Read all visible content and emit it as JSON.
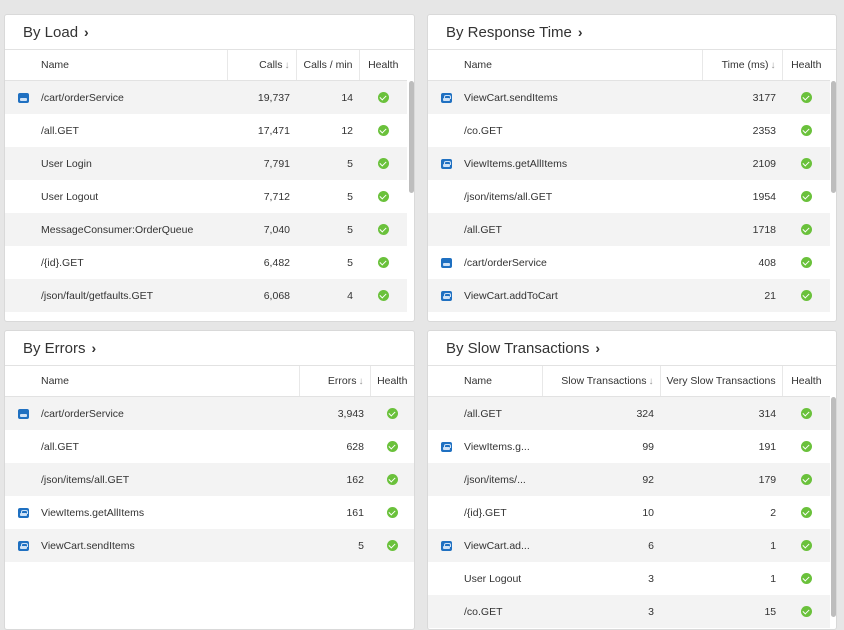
{
  "panels": {
    "load": {
      "title": "By Load",
      "chevron": "›",
      "headers": [
        "Name",
        "Calls",
        "Calls / min",
        "Health"
      ],
      "sort_arrow": "↓",
      "rows": [
        {
          "icon": "service-icon",
          "name": "/cart/orderService",
          "c1": "19,737",
          "c2": "14",
          "health": "ok-icon"
        },
        {
          "icon": "",
          "name": "/all.GET",
          "c1": "17,471",
          "c2": "12",
          "health": "ok-icon"
        },
        {
          "icon": "",
          "name": "User Login",
          "c1": "7,791",
          "c2": "5",
          "health": "ok-icon"
        },
        {
          "icon": "",
          "name": "User Logout",
          "c1": "7,712",
          "c2": "5",
          "health": "ok-icon"
        },
        {
          "icon": "",
          "name": "MessageConsumer:OrderQueue",
          "c1": "7,040",
          "c2": "5",
          "health": "ok-icon"
        },
        {
          "icon": "",
          "name": "/{id}.GET",
          "c1": "6,482",
          "c2": "5",
          "health": "ok-icon"
        },
        {
          "icon": "",
          "name": "/json/fault/getfaults.GET",
          "c1": "6,068",
          "c2": "4",
          "health": "ok-icon"
        }
      ]
    },
    "response": {
      "title": "By Response Time",
      "chevron": "›",
      "headers": [
        "Name",
        "Time (ms)",
        "Health"
      ],
      "sort_arrow": "↓",
      "rows": [
        {
          "icon": "cart-icon",
          "name": "ViewCart.sendItems",
          "c1": "3177",
          "health": "ok-icon"
        },
        {
          "icon": "",
          "name": "/co.GET",
          "c1": "2353",
          "health": "ok-icon"
        },
        {
          "icon": "cart-icon",
          "name": "ViewItems.getAllItems",
          "c1": "2109",
          "health": "ok-icon"
        },
        {
          "icon": "",
          "name": "/json/items/all.GET",
          "c1": "1954",
          "health": "ok-icon"
        },
        {
          "icon": "",
          "name": "/all.GET",
          "c1": "1718",
          "health": "ok-icon"
        },
        {
          "icon": "service-icon",
          "name": "/cart/orderService",
          "c1": "408",
          "health": "ok-icon"
        },
        {
          "icon": "cart-icon",
          "name": "ViewCart.addToCart",
          "c1": "21",
          "health": "ok-icon"
        }
      ]
    },
    "errors": {
      "title": "By Errors",
      "chevron": "›",
      "headers": [
        "Name",
        "Errors",
        "Health"
      ],
      "sort_arrow": "↓",
      "rows": [
        {
          "icon": "service-icon",
          "name": "/cart/orderService",
          "c1": "3,943",
          "health": "ok-icon"
        },
        {
          "icon": "",
          "name": "/all.GET",
          "c1": "628",
          "health": "ok-icon"
        },
        {
          "icon": "",
          "name": "/json/items/all.GET",
          "c1": "162",
          "health": "ok-icon"
        },
        {
          "icon": "cart-icon",
          "name": "ViewItems.getAllItems",
          "c1": "161",
          "health": "ok-icon"
        },
        {
          "icon": "cart-icon",
          "name": "ViewCart.sendItems",
          "c1": "5",
          "health": "ok-icon"
        }
      ]
    },
    "slow": {
      "title": "By Slow Transactions",
      "chevron": "›",
      "headers": [
        "Name",
        "Slow Transactions",
        "Very Slow Transactions",
        "Health"
      ],
      "sort_arrow": "↓",
      "rows": [
        {
          "icon": "",
          "name": "/all.GET",
          "c1": "324",
          "c2": "314",
          "health": "ok-icon"
        },
        {
          "icon": "cart-icon",
          "name": "ViewItems.g...",
          "c1": "99",
          "c2": "191",
          "health": "ok-icon"
        },
        {
          "icon": "",
          "name": "/json/items/...",
          "c1": "92",
          "c2": "179",
          "health": "ok-icon"
        },
        {
          "icon": "",
          "name": "/{id}.GET",
          "c1": "10",
          "c2": "2",
          "health": "ok-icon"
        },
        {
          "icon": "cart-icon",
          "name": "ViewCart.ad...",
          "c1": "6",
          "c2": "1",
          "health": "ok-icon"
        },
        {
          "icon": "",
          "name": "User Logout",
          "c1": "3",
          "c2": "1",
          "health": "ok-icon"
        },
        {
          "icon": "",
          "name": "/co.GET",
          "c1": "3",
          "c2": "15",
          "health": "ok-icon"
        }
      ]
    }
  },
  "colors": {
    "icon_blue": "#1f70c1",
    "health_green": "#6ac13b",
    "row_alt": "#f3f3f3"
  }
}
